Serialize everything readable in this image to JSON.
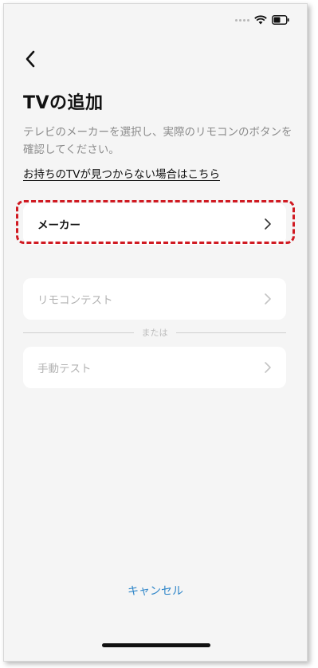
{
  "header": {
    "back_icon": "chevron-left-icon",
    "title": "TVの追加"
  },
  "main": {
    "description": "テレビのメーカーを選択し、実際のリモコンのボタンを確認してください。",
    "help_link": "お持ちのTVが見つからない場合はこちら",
    "options": [
      {
        "label": "メーカー",
        "state": "active",
        "icon": "chevron-right-icon"
      },
      {
        "label": "リモコンテスト",
        "state": "disabled",
        "icon": "chevron-right-icon"
      },
      {
        "label": "手動テスト",
        "state": "disabled",
        "icon": "chevron-right-icon"
      }
    ],
    "divider_text": "または"
  },
  "footer": {
    "cancel_label": "キャンセル"
  },
  "colors": {
    "accent": "#2f86c9",
    "highlight": "#d01a22",
    "background": "#f5f5f5"
  }
}
